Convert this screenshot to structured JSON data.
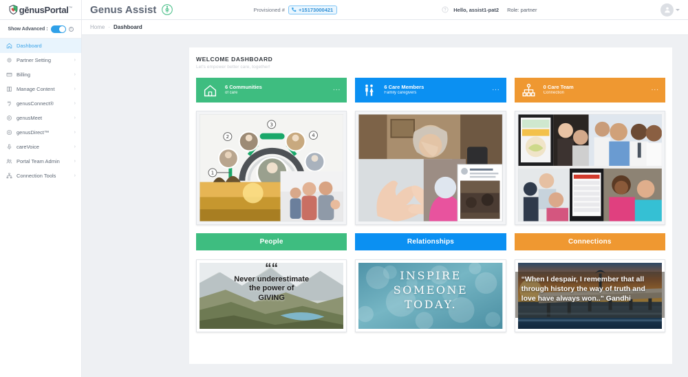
{
  "brand": {
    "logo_text": "gēnusPortal",
    "logo_sup": "™",
    "logo_icon": "shield-heart-icon"
  },
  "topbar": {
    "app_name": "Genus Assist",
    "app_icon": "genus-tree-icon",
    "provisioned_label": "Provisioned #",
    "provisioned_number": "+15173000421",
    "phone_icon": "phone-icon",
    "help_icon": "question-circle-icon",
    "greeting": "Hello, assist1-pat2",
    "role": "Role: partner",
    "avatar_icon": "user-avatar-icon"
  },
  "sidebar": {
    "show_advanced_label": "Show Advanced :",
    "toggle_state": "on",
    "info_icon": "info-icon",
    "items": [
      {
        "label": "Dashboard",
        "icon": "home-icon",
        "active": true,
        "chevron": false
      },
      {
        "label": "Partner Setting",
        "icon": "gear-icon",
        "active": false,
        "chevron": true
      },
      {
        "label": "Billing",
        "icon": "card-icon",
        "active": false,
        "chevron": true
      },
      {
        "label": "Manage Content",
        "icon": "book-icon",
        "active": false,
        "chevron": true
      },
      {
        "label": "genusConnect®",
        "icon": "plug-icon",
        "active": false,
        "chevron": true
      },
      {
        "label": "genusMeet",
        "icon": "video-icon",
        "active": false,
        "chevron": true
      },
      {
        "label": "genusDirect™",
        "icon": "target-icon",
        "active": false,
        "chevron": true
      },
      {
        "label": "careVoice",
        "icon": "microphone-icon",
        "active": false,
        "chevron": true
      },
      {
        "label": "Portal Team Admin",
        "icon": "users-icon",
        "active": false,
        "chevron": true
      },
      {
        "label": "Connection Tools",
        "icon": "network-icon",
        "active": false,
        "chevron": true
      }
    ]
  },
  "breadcrumb": {
    "home": "Home",
    "separator": "·",
    "current": "Dashboard"
  },
  "dashboard": {
    "title": "WELCOME DASHBOARD",
    "subtitle": "Let's empower better care, together!",
    "stats": [
      {
        "count_label": "6 Communities",
        "sub": "of care",
        "color": "#3ebd80",
        "icon": "house-outline-icon",
        "menu": "..."
      },
      {
        "count_label": "6 Care Members",
        "sub": "Family caregivers",
        "color": "#0b90f2",
        "icon": "two-people-icon",
        "menu": "..."
      },
      {
        "count_label": "0 Care Team",
        "sub": "Connection",
        "color": "#ef9831",
        "icon": "org-chart-icon",
        "menu": "..."
      }
    ],
    "photos": [
      {
        "name": "care-circle-collage",
        "alt": "Care circle diagram with numbered member photos over farm and family images"
      },
      {
        "name": "caregiving-collage",
        "alt": "Elderly woman at window, heart hands, and group meeting photos"
      },
      {
        "name": "care-professionals-collage",
        "alt": "Meal tablet, nurses and caregivers collage"
      }
    ],
    "bars": [
      {
        "label": "People",
        "color": "#3ebd80"
      },
      {
        "label": "Relationships",
        "color": "#0b90f2"
      },
      {
        "label": "Connections",
        "color": "#ef9831"
      }
    ],
    "quotes": [
      {
        "name": "quote-giving",
        "mark": "““",
        "line1": "Never underestimate",
        "line2": "the power of",
        "line3": "GIVING",
        "background": "mountain-valley-photo"
      },
      {
        "name": "quote-inspire",
        "line1": "INSPIRE",
        "line2": "SOMEONE",
        "line3": "TODAY.",
        "background": "teal-bokeh-photo"
      },
      {
        "name": "quote-gandhi",
        "text": "“When I despair, I remember that all through history the way of truth and love have always won..”  Gandhi",
        "background": "sunset-pier-photo"
      }
    ]
  },
  "colors": {
    "green": "#3ebd80",
    "blue": "#0b90f2",
    "orange": "#ef9831",
    "sidebar_active_bg": "#e8f4fd",
    "sidebar_active_fg": "#3ba3e8",
    "page_bg": "#eef0f3"
  }
}
